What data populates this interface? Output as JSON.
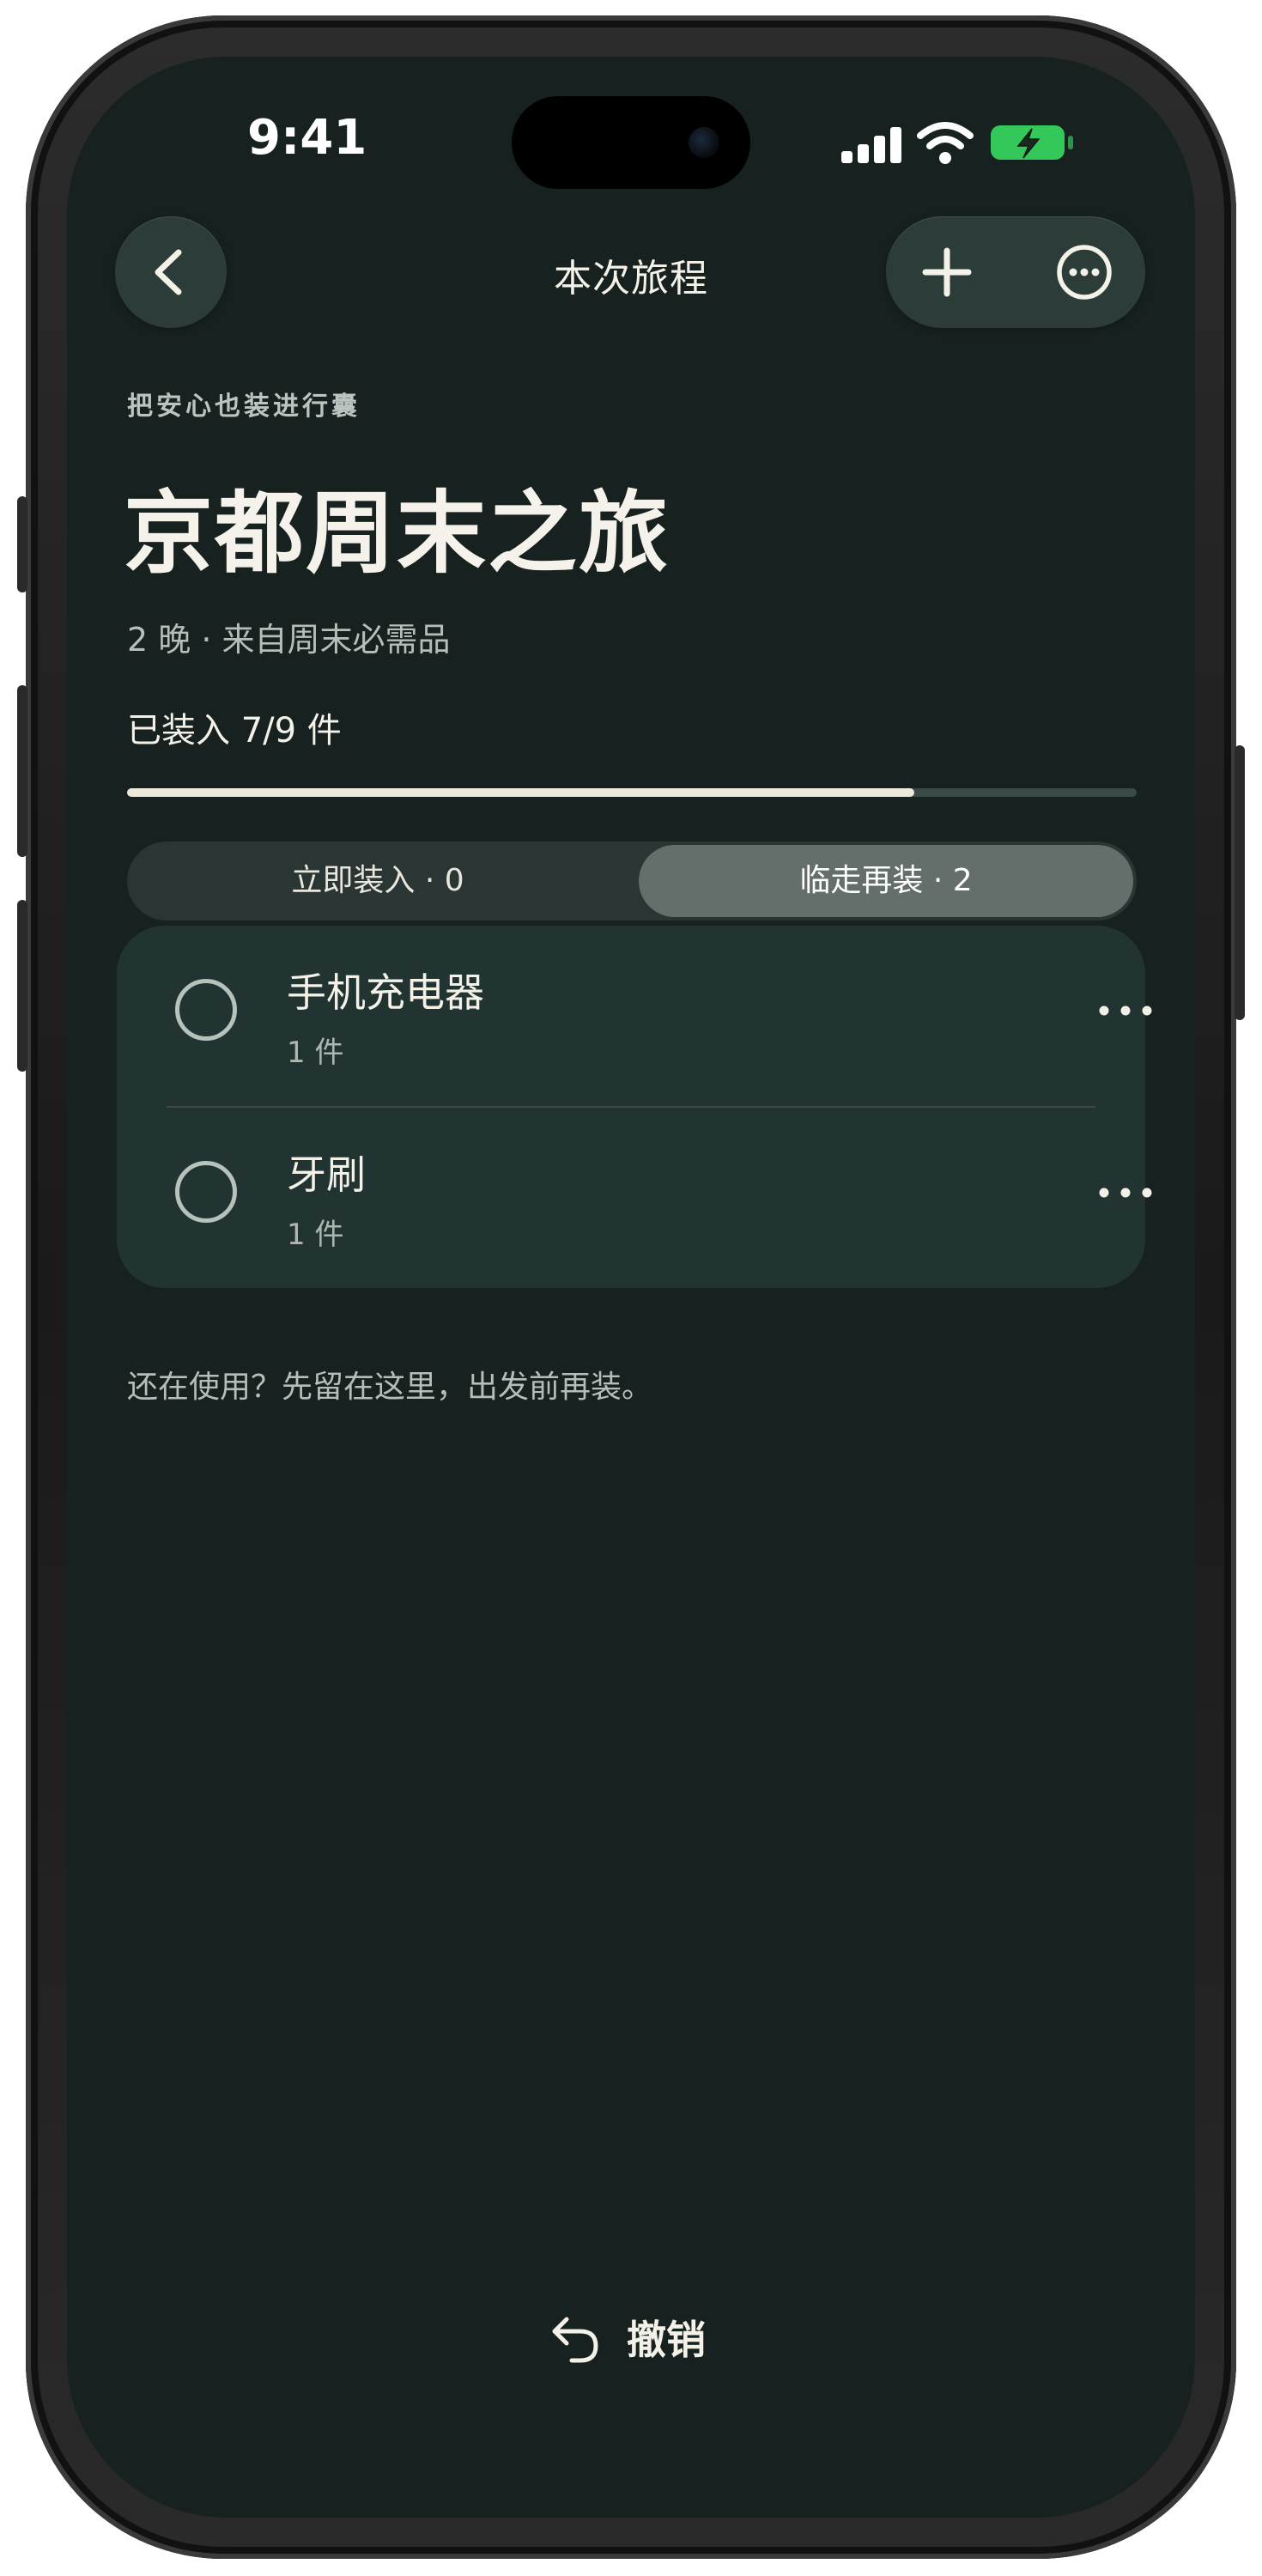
{
  "status_bar": {
    "time": "9:41"
  },
  "nav": {
    "title": "本次旅程",
    "back_icon": "chevron-left-icon",
    "add_icon": "plus-icon",
    "more_icon": "ellipsis-circle-icon"
  },
  "trip": {
    "tagline": "把安心也装进行囊",
    "title": "京都周末之旅",
    "meta": "2 晚 · 来自周末必需品",
    "packed_label": "已装入 7/9 件",
    "progress_fraction": 0.78
  },
  "segments": [
    {
      "label": "立即装入 · 0",
      "active": false
    },
    {
      "label": "临走再装 · 2",
      "active": true
    }
  ],
  "items": [
    {
      "name": "手机充电器",
      "qty": "1 件"
    },
    {
      "name": "牙刷",
      "qty": "1 件"
    }
  ],
  "hint": "还在使用？先留在这里，出发前再装。",
  "undo": {
    "label": "撤销",
    "icon": "undo-arrow-icon"
  },
  "colors": {
    "background": "#17211f",
    "card": "#223431",
    "accent_fill": "#eeeadb",
    "battery_green": "#34c759"
  }
}
